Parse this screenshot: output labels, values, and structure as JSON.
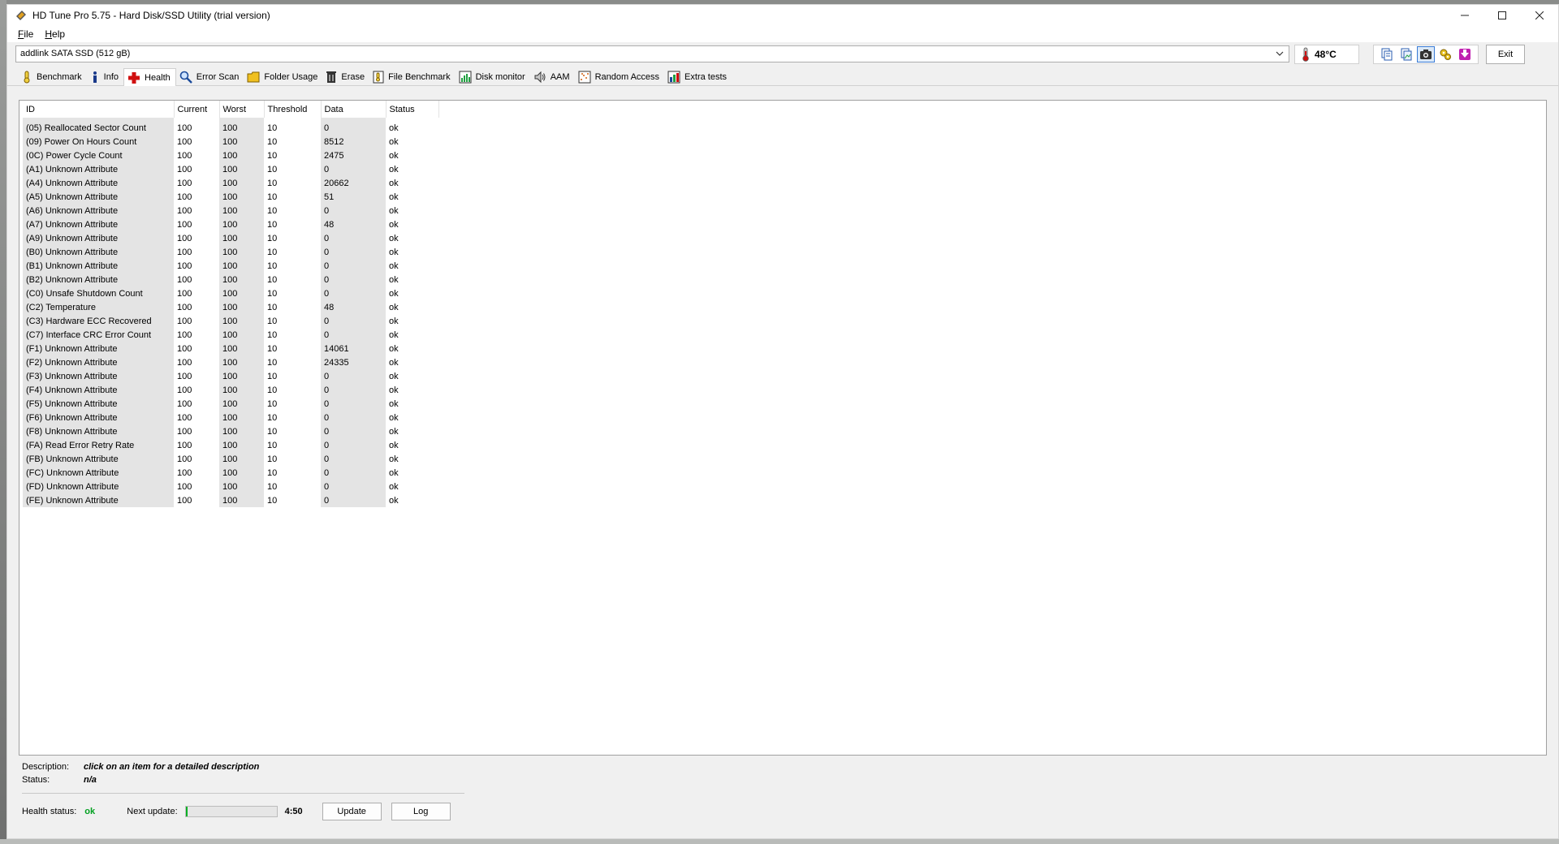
{
  "window": {
    "title": "HD Tune Pro 5.75 - Hard Disk/SSD Utility (trial version)"
  },
  "menu": [
    {
      "label": "File",
      "accel": "F",
      "rest": "ile"
    },
    {
      "label": "Help",
      "accel": "H",
      "rest": "elp"
    }
  ],
  "device": {
    "selected": "addlink SATA SSD (512 gB)",
    "temperature": "48°C",
    "exit_label": "Exit"
  },
  "tabs": [
    {
      "label": "Benchmark",
      "icon": "benchmark-icon",
      "active": false
    },
    {
      "label": "Info",
      "icon": "info-icon",
      "active": false
    },
    {
      "label": "Health",
      "icon": "health-icon",
      "active": true
    },
    {
      "label": "Error Scan",
      "icon": "error-scan-icon",
      "active": false
    },
    {
      "label": "Folder Usage",
      "icon": "folder-icon",
      "active": false
    },
    {
      "label": "Erase",
      "icon": "trash-icon",
      "active": false
    },
    {
      "label": "File Benchmark",
      "icon": "file-benchmark-icon",
      "active": false
    },
    {
      "label": "Disk monitor",
      "icon": "disk-monitor-icon",
      "active": false
    },
    {
      "label": "AAM",
      "icon": "speaker-icon",
      "active": false
    },
    {
      "label": "Random Access",
      "icon": "random-access-icon",
      "active": false
    },
    {
      "label": "Extra tests",
      "icon": "extra-tests-icon",
      "active": false
    }
  ],
  "table": {
    "columns": [
      "ID",
      "Current",
      "Worst",
      "Threshold",
      "Data",
      "Status"
    ],
    "rows": [
      [
        "(05) Reallocated Sector Count",
        "100",
        "100",
        "10",
        "0",
        "ok"
      ],
      [
        "(09) Power On Hours Count",
        "100",
        "100",
        "10",
        "8512",
        "ok"
      ],
      [
        "(0C) Power Cycle Count",
        "100",
        "100",
        "10",
        "2475",
        "ok"
      ],
      [
        "(A1) Unknown Attribute",
        "100",
        "100",
        "10",
        "0",
        "ok"
      ],
      [
        "(A4) Unknown Attribute",
        "100",
        "100",
        "10",
        "20662",
        "ok"
      ],
      [
        "(A5) Unknown Attribute",
        "100",
        "100",
        "10",
        "51",
        "ok"
      ],
      [
        "(A6) Unknown Attribute",
        "100",
        "100",
        "10",
        "0",
        "ok"
      ],
      [
        "(A7) Unknown Attribute",
        "100",
        "100",
        "10",
        "48",
        "ok"
      ],
      [
        "(A9) Unknown Attribute",
        "100",
        "100",
        "10",
        "0",
        "ok"
      ],
      [
        "(B0) Unknown Attribute",
        "100",
        "100",
        "10",
        "0",
        "ok"
      ],
      [
        "(B1) Unknown Attribute",
        "100",
        "100",
        "10",
        "0",
        "ok"
      ],
      [
        "(B2) Unknown Attribute",
        "100",
        "100",
        "10",
        "0",
        "ok"
      ],
      [
        "(C0) Unsafe Shutdown Count",
        "100",
        "100",
        "10",
        "0",
        "ok"
      ],
      [
        "(C2) Temperature",
        "100",
        "100",
        "10",
        "48",
        "ok"
      ],
      [
        "(C3) Hardware ECC Recovered",
        "100",
        "100",
        "10",
        "0",
        "ok"
      ],
      [
        "(C7) Interface CRC Error Count",
        "100",
        "100",
        "10",
        "0",
        "ok"
      ],
      [
        "(F1) Unknown Attribute",
        "100",
        "100",
        "10",
        "14061",
        "ok"
      ],
      [
        "(F2) Unknown Attribute",
        "100",
        "100",
        "10",
        "24335",
        "ok"
      ],
      [
        "(F3) Unknown Attribute",
        "100",
        "100",
        "10",
        "0",
        "ok"
      ],
      [
        "(F4) Unknown Attribute",
        "100",
        "100",
        "10",
        "0",
        "ok"
      ],
      [
        "(F5) Unknown Attribute",
        "100",
        "100",
        "10",
        "0",
        "ok"
      ],
      [
        "(F6) Unknown Attribute",
        "100",
        "100",
        "10",
        "0",
        "ok"
      ],
      [
        "(F8) Unknown Attribute",
        "100",
        "100",
        "10",
        "0",
        "ok"
      ],
      [
        "(FA) Read Error Retry Rate",
        "100",
        "100",
        "10",
        "0",
        "ok"
      ],
      [
        "(FB) Unknown Attribute",
        "100",
        "100",
        "10",
        "0",
        "ok"
      ],
      [
        "(FC) Unknown Attribute",
        "100",
        "100",
        "10",
        "0",
        "ok"
      ],
      [
        "(FD) Unknown Attribute",
        "100",
        "100",
        "10",
        "0",
        "ok"
      ],
      [
        "(FE) Unknown Attribute",
        "100",
        "100",
        "10",
        "0",
        "ok"
      ]
    ]
  },
  "description": {
    "desc_label": "Description:",
    "desc_value": "click on an item for a detailed description",
    "status_label": "Status:",
    "status_value": "n/a"
  },
  "health": {
    "status_label": "Health status:",
    "status_value": "ok",
    "status_color": "#00a020",
    "next_update_label": "Next update:",
    "progress_fraction": 0.02,
    "countdown": "4:50",
    "update_label": "Update",
    "log_label": "Log"
  }
}
